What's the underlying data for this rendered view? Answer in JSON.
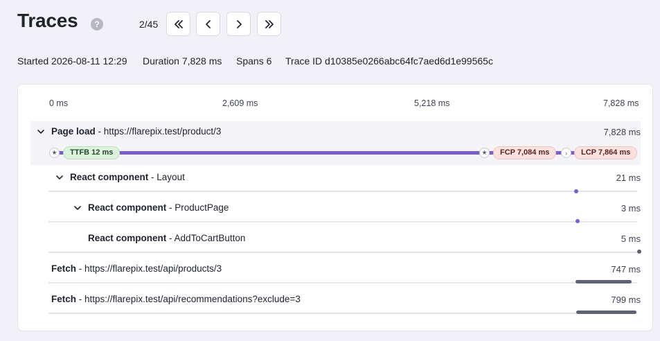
{
  "header": {
    "title": "Traces",
    "help_icon": "?",
    "pager": "2/45"
  },
  "meta": {
    "started_label": "Started",
    "started_value": "2026-08-11 12:29",
    "duration_label": "Duration",
    "duration_value": "7,828 ms",
    "spans_label": "Spans",
    "spans_value": "6",
    "trace_label": "Trace ID",
    "trace_value": "d10385e0266abc64fc7aed6d1e99565c"
  },
  "timeline": {
    "ticks": [
      "0 ms",
      "2,609 ms",
      "5,218 ms",
      "7,828 ms"
    ],
    "total_ms": 7828
  },
  "root": {
    "kind": "Page load",
    "name": "- https://flarepix.test/product/3",
    "duration": "7,828 ms",
    "markers": {
      "ttfb": "TTFB 12 ms",
      "fcp": "FCP 7,084 ms",
      "lcp": "LCP 7,864 ms"
    }
  },
  "spans": [
    {
      "kind": "React component",
      "name": "- Layout",
      "duration": "21 ms"
    },
    {
      "kind": "React component",
      "name": "- ProductPage",
      "duration": "3 ms"
    },
    {
      "kind": "React component",
      "name": "- AddToCartButton",
      "duration": "5 ms"
    },
    {
      "kind": "Fetch",
      "name": "- https://flarepix.test/api/products/3",
      "duration": "747 ms"
    },
    {
      "kind": "Fetch",
      "name": "- https://flarepix.test/api/recommendations?exclude=3",
      "duration": "799 ms"
    }
  ],
  "colors": {
    "accent": "#7b5dcc",
    "fetch_bar": "#5e6273"
  },
  "icons": [
    "help-icon",
    "first-page-icon",
    "previous-icon",
    "next-icon",
    "last-page-icon",
    "chevron-down-icon",
    "star-icon",
    "chevron-right-icon"
  ]
}
